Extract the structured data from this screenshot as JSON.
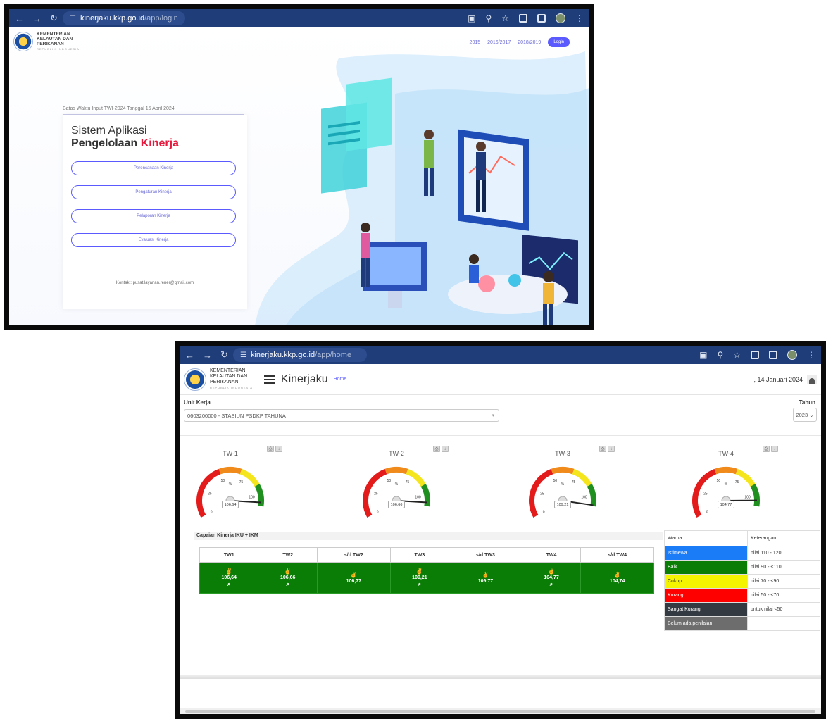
{
  "login_window": {
    "url_host": "kinerjaku.kkp.go.id",
    "url_path": "/app/login",
    "org": {
      "line1": "KEMENTERIAN",
      "line2": "KELAUTAN DAN",
      "line3": "PERIKANAN",
      "sub": "REPUBLIK INDONESIA"
    },
    "year_links": [
      "2015",
      "2016/2017",
      "2018/2019"
    ],
    "login_label": "Login",
    "deadline_note": "Batas Waktu Input TWI-2024 Tanggal 15 April 2024",
    "title_line1": "Sistem Aplikasi",
    "title_line2_prefix": "Pengelolaan ",
    "title_line2_highlight": "Kinerja",
    "menu": [
      "Perencanaan Kinerja",
      "Pengaturan Kinerja",
      "Pelaporan Kinerja",
      "Evaluasi Kinerja"
    ],
    "contact": "Kontak : pusat.layanan.rener@gmail.com"
  },
  "home_window": {
    "url_host": "kinerjaku.kkp.go.id",
    "url_path": "/app/home",
    "org": {
      "line1": "KEMENTERIAN",
      "line2": "KELAUTAN DAN",
      "line3": "PERIKANAN",
      "sub": "REPUBLIK INDONESIA"
    },
    "brand": "Kinerjaku",
    "breadcrumb": "Home",
    "date": ", 14 Januari 2024",
    "unit_label": "Unit Kerja",
    "unit_value": "0603200000 - STASIUN PSDKP TAHUNA",
    "tahun_label": "Tahun",
    "tahun_value": "2023",
    "gauges": [
      {
        "label": "TW-1",
        "value": 106.64,
        "display": "106.64"
      },
      {
        "label": "TW-2",
        "value": 106.66,
        "display": "106.66"
      },
      {
        "label": "TW-3",
        "value": 109.21,
        "display": "109.21"
      },
      {
        "label": "TW-4",
        "value": 104.77,
        "display": "104.77"
      }
    ],
    "gauge_ticks": [
      "0",
      "25",
      "50",
      "75",
      "100"
    ],
    "gauge_unit": "%",
    "capaian_title": "Capaian Kinerja IKU + IKM",
    "capaian_headers": [
      "TW1",
      "TW2",
      "s/d TW2",
      "TW3",
      "s/d TW3",
      "TW4",
      "s/d TW4"
    ],
    "capaian_values": [
      {
        "value": "106,64",
        "search": true
      },
      {
        "value": "106,66",
        "search": true
      },
      {
        "value": "106,77",
        "search": false
      },
      {
        "value": "109,21",
        "search": true
      },
      {
        "value": "109,77",
        "search": false
      },
      {
        "value": "104,77",
        "search": true
      },
      {
        "value": "104,74",
        "search": false
      }
    ],
    "legend_headers": {
      "color": "Warna",
      "desc": "Keterangan"
    },
    "legend": [
      {
        "name": "Istimewa",
        "desc": "nilai 110 - 120",
        "color": "#1a7cf7"
      },
      {
        "name": "Baik",
        "desc": "nilai 90 - <110",
        "color": "#0a7d07"
      },
      {
        "name": "Cukup",
        "desc": "nilai 70 - <90",
        "color": "#f4f400"
      },
      {
        "name": "Kurang",
        "desc": "nilai 50 - <70",
        "color": "#ff0000"
      },
      {
        "name": "Sangat Kurang",
        "desc": "untuk nilai <50",
        "color": "#333a41"
      },
      {
        "name": "Belum ada penilaian",
        "desc": "",
        "color": "#6d6d6d"
      }
    ]
  }
}
